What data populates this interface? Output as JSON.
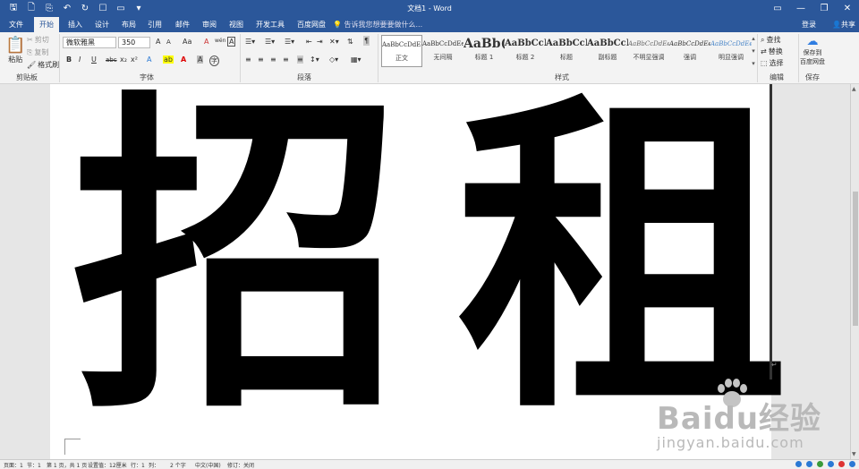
{
  "window": {
    "title": "文档1 - Word"
  },
  "qat": {
    "icons": [
      "save-icon",
      "new-doc-icon",
      "open-icon",
      "undo-icon",
      "redo-icon",
      "print-preview-icon",
      "folder-icon",
      "customize-qat-icon"
    ]
  },
  "window_controls": {
    "help": "?",
    "restore_ribbon": "▭",
    "minimize": "—",
    "maximize": "❐",
    "close": "✕"
  },
  "tabs": [
    {
      "label": "文件"
    },
    {
      "label": "开始"
    },
    {
      "label": "插入"
    },
    {
      "label": "设计"
    },
    {
      "label": "布局"
    },
    {
      "label": "引用"
    },
    {
      "label": "邮件"
    },
    {
      "label": "审阅"
    },
    {
      "label": "视图"
    },
    {
      "label": "开发工具"
    },
    {
      "label": "百度网盘"
    }
  ],
  "tell_me": "告诉我您想要要做什么...",
  "account": {
    "login": "登录",
    "share": "共享"
  },
  "clipboard": {
    "paste": "粘贴",
    "cut": "剪切",
    "copy": "复制",
    "format_painter": "格式刷",
    "group": "剪贴板"
  },
  "font": {
    "name": "微软雅黑",
    "size": "350",
    "grow": "A",
    "shrink": "A",
    "case": "Aa",
    "clear": "A",
    "phonetic": "wén",
    "border": "A",
    "bold": "B",
    "italic": "I",
    "underline": "U",
    "strike": "abc",
    "sub": "x₂",
    "sup": "x²",
    "effects": "A",
    "highlight": "ab",
    "color": "A",
    "shading": "A",
    "circle": "字",
    "group": "字体"
  },
  "paragraph": {
    "group": "段落"
  },
  "styles": {
    "items": [
      {
        "preview": "AaBbCcDdEe",
        "name": "正文"
      },
      {
        "preview": "AaBbCcDdEe",
        "name": "无间隔"
      },
      {
        "preview": "AaBb(",
        "name": "标题 1"
      },
      {
        "preview": "AaBbCcI",
        "name": "标题 2"
      },
      {
        "preview": "AaBbCcI",
        "name": "标题"
      },
      {
        "preview": "AaBbCcI",
        "name": "副标题"
      },
      {
        "preview": "AaBbCcDdEe",
        "name": "不明显强调"
      },
      {
        "preview": "AaBbCcDdEe",
        "name": "强调"
      },
      {
        "preview": "AaBbCcDdEe",
        "name": "明显强调"
      }
    ],
    "group": "样式"
  },
  "editing": {
    "find": "查找",
    "replace": "替换",
    "select": "选择",
    "group": "编辑"
  },
  "save_group": {
    "line1": "保存到",
    "line2": "百度网盘",
    "group": "保存"
  },
  "document": {
    "text": "招租"
  },
  "watermark": {
    "line1": "Baidu经验",
    "line2": "jingyan.baidu.com"
  },
  "status": {
    "page": "页面：1",
    "section": "节：1",
    "page_of": "第 1 页，共 1 页",
    "position": "设置值：12厘米",
    "line": "行：1",
    "column": "列：",
    "words": "2 个字",
    "lang": "中文(中国)",
    "track": "修订：关闭"
  },
  "colors": {
    "accent": "#2b579a",
    "ribbon_bg": "#f3f3f3",
    "doc_bg": "#e6e6e6"
  }
}
